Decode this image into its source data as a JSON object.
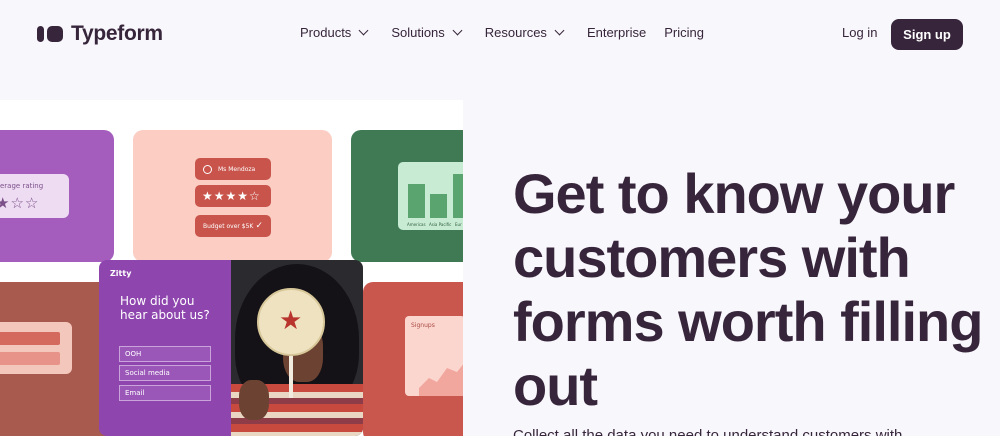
{
  "header": {
    "brand": "Typeform",
    "nav": [
      {
        "label": "Products",
        "has_menu": true
      },
      {
        "label": "Solutions",
        "has_menu": true
      },
      {
        "label": "Resources",
        "has_menu": true
      },
      {
        "label": "Enterprise",
        "has_menu": false
      },
      {
        "label": "Pricing",
        "has_menu": false
      }
    ],
    "login_label": "Log in",
    "signup_label": "Sign up"
  },
  "collage": {
    "rating_label": "erage rating",
    "rating_stars": "★☆☆",
    "name_field": "Ms Mendoza",
    "stars_field": "★★★★☆",
    "budget_field": "Budget over $5K",
    "chart_labels": [
      "Americas",
      "Asia Pacific",
      "Eur"
    ],
    "form_brand": "Zitty",
    "form_question": "How did you hear about us?",
    "form_options": [
      "OOH",
      "Social media",
      "Email"
    ],
    "signups_label": "Signups"
  },
  "hero": {
    "headline": "Get to know your customers with forms worth filling out",
    "subtext": "Collect all the data you need to understand customers with"
  },
  "colors": {
    "brand_dark": "#37263b",
    "background": "#f8f7fb"
  }
}
